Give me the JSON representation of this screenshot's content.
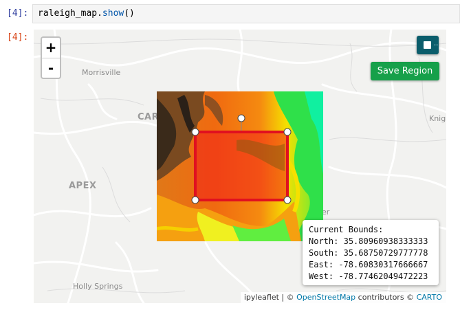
{
  "notebook": {
    "input_prompt": "[4]:",
    "output_prompt": "[4]:",
    "code_object": "raleigh_map.",
    "code_method": "show",
    "code_args": "()"
  },
  "map": {
    "places": {
      "morrisville": "Morrisville",
      "cary": "CAR",
      "apex": "APEX",
      "knightdale": "Knig",
      "garner": "er",
      "holly_springs": "Holly Springs"
    },
    "zoom_in_label": "+",
    "zoom_out_label": "-",
    "draw_button_dots": "..",
    "save_button_label": "Save Region",
    "bounds": {
      "title": "Current Bounds:",
      "north_label": "North:",
      "north": "35.80960938333333",
      "south_label": "South:",
      "south": "35.68750729777778",
      "east_label": "East:",
      "east": "-78.60830317666667",
      "west_label": "West:",
      "west": "-78.77462049472223"
    },
    "attribution": {
      "prefix": "ipyleaflet | © ",
      "osm": "OpenStreetMap",
      "middle": " contributors © ",
      "carto": "CARTO"
    }
  }
}
